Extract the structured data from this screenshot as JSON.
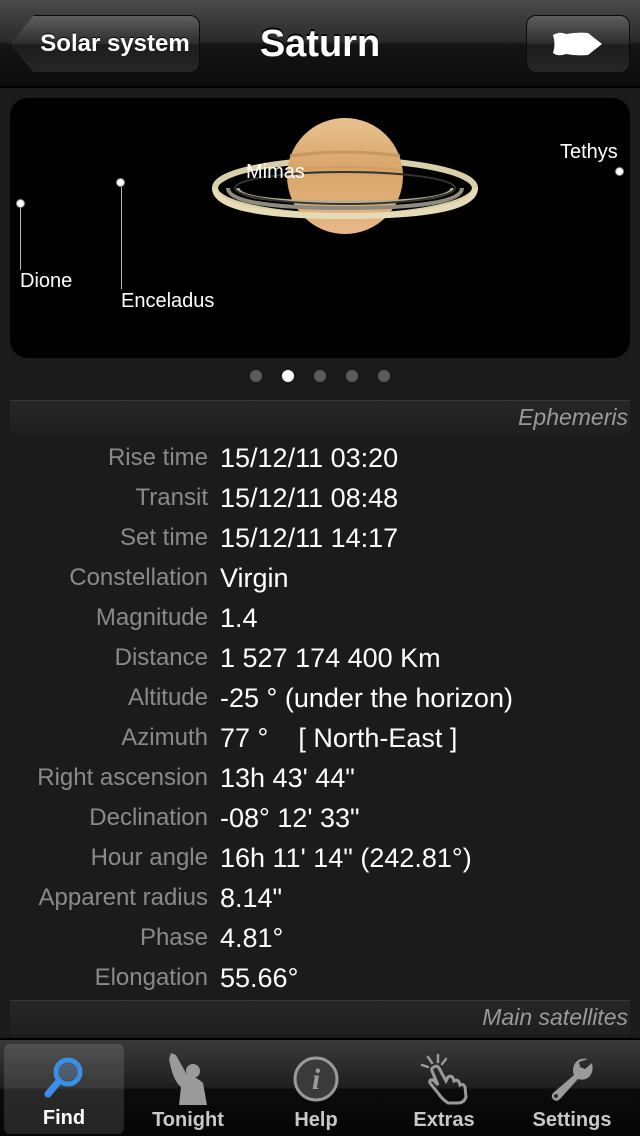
{
  "nav": {
    "back_label": "Solar system",
    "title": "Saturn",
    "forward_icon": "arrow-right-icon"
  },
  "sky": {
    "moons": [
      "Dione",
      "Enceladus",
      "Mimas",
      "Tethys"
    ],
    "planet_icon": "saturn-image"
  },
  "pager": {
    "count": 5,
    "current": 2
  },
  "sections": {
    "ephemeris": "Ephemeris",
    "satellites": "Main satellites"
  },
  "ephemeris": [
    {
      "label": "Rise time",
      "value": "15/12/11 03:20"
    },
    {
      "label": "Transit",
      "value": "15/12/11 08:48"
    },
    {
      "label": "Set time",
      "value": "15/12/11 14:17"
    },
    {
      "label": "Constellation",
      "value": "Virgin"
    },
    {
      "label": "Magnitude",
      "value": "1.4"
    },
    {
      "label": "Distance",
      "value": "1 527 174 400 Km"
    },
    {
      "label": "Altitude",
      "value": "-25 ° (under the horizon)"
    },
    {
      "label": "Azimuth",
      "value": "77 °    [ North-East ]"
    },
    {
      "label": "Right ascension",
      "value": "13h 43' 44\""
    },
    {
      "label": "Declination",
      "value": "-08° 12' 33\""
    },
    {
      "label": "Hour angle",
      "value": "16h 11' 14\" (242.81°)"
    },
    {
      "label": "Apparent radius",
      "value": "8.14\""
    },
    {
      "label": "Phase",
      "value": "4.81°"
    },
    {
      "label": "Elongation",
      "value": "55.66°"
    }
  ],
  "tabs": [
    {
      "label": "Find",
      "icon": "magnifier-icon",
      "active": true
    },
    {
      "label": "Tonight",
      "icon": "stargazer-icon",
      "active": false
    },
    {
      "label": "Help",
      "icon": "info-icon",
      "active": false
    },
    {
      "label": "Extras",
      "icon": "tap-hand-icon",
      "active": false
    },
    {
      "label": "Settings",
      "icon": "wrench-icon",
      "active": false
    }
  ],
  "colors": {
    "accent_blue": "#3b8fe8",
    "label_gray": "#8a8a8a",
    "section_gray": "#9a9a9a"
  }
}
